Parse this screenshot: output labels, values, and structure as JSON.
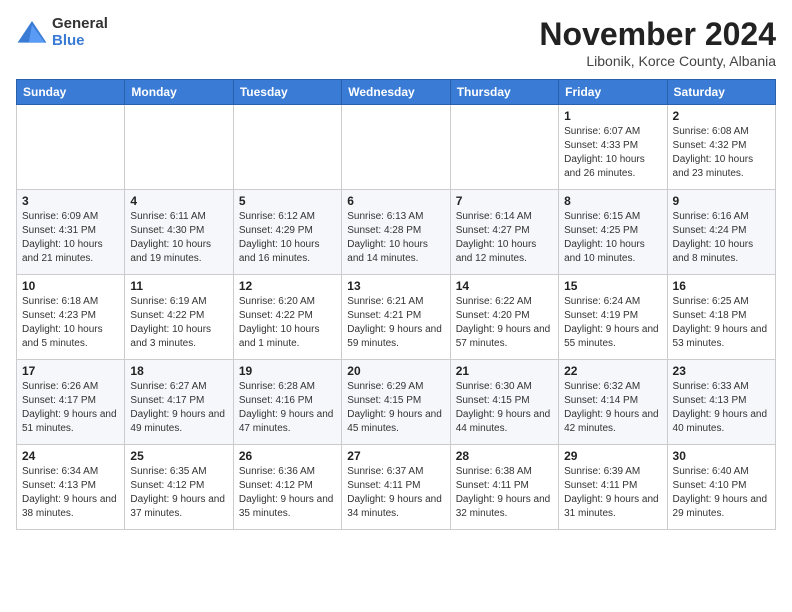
{
  "logo": {
    "general": "General",
    "blue": "Blue"
  },
  "title": "November 2024",
  "subtitle": "Libonik, Korce County, Albania",
  "days_of_week": [
    "Sunday",
    "Monday",
    "Tuesday",
    "Wednesday",
    "Thursday",
    "Friday",
    "Saturday"
  ],
  "weeks": [
    [
      {
        "day": "",
        "info": ""
      },
      {
        "day": "",
        "info": ""
      },
      {
        "day": "",
        "info": ""
      },
      {
        "day": "",
        "info": ""
      },
      {
        "day": "",
        "info": ""
      },
      {
        "day": "1",
        "info": "Sunrise: 6:07 AM\nSunset: 4:33 PM\nDaylight: 10 hours and 26 minutes."
      },
      {
        "day": "2",
        "info": "Sunrise: 6:08 AM\nSunset: 4:32 PM\nDaylight: 10 hours and 23 minutes."
      }
    ],
    [
      {
        "day": "3",
        "info": "Sunrise: 6:09 AM\nSunset: 4:31 PM\nDaylight: 10 hours and 21 minutes."
      },
      {
        "day": "4",
        "info": "Sunrise: 6:11 AM\nSunset: 4:30 PM\nDaylight: 10 hours and 19 minutes."
      },
      {
        "day": "5",
        "info": "Sunrise: 6:12 AM\nSunset: 4:29 PM\nDaylight: 10 hours and 16 minutes."
      },
      {
        "day": "6",
        "info": "Sunrise: 6:13 AM\nSunset: 4:28 PM\nDaylight: 10 hours and 14 minutes."
      },
      {
        "day": "7",
        "info": "Sunrise: 6:14 AM\nSunset: 4:27 PM\nDaylight: 10 hours and 12 minutes."
      },
      {
        "day": "8",
        "info": "Sunrise: 6:15 AM\nSunset: 4:25 PM\nDaylight: 10 hours and 10 minutes."
      },
      {
        "day": "9",
        "info": "Sunrise: 6:16 AM\nSunset: 4:24 PM\nDaylight: 10 hours and 8 minutes."
      }
    ],
    [
      {
        "day": "10",
        "info": "Sunrise: 6:18 AM\nSunset: 4:23 PM\nDaylight: 10 hours and 5 minutes."
      },
      {
        "day": "11",
        "info": "Sunrise: 6:19 AM\nSunset: 4:22 PM\nDaylight: 10 hours and 3 minutes."
      },
      {
        "day": "12",
        "info": "Sunrise: 6:20 AM\nSunset: 4:22 PM\nDaylight: 10 hours and 1 minute."
      },
      {
        "day": "13",
        "info": "Sunrise: 6:21 AM\nSunset: 4:21 PM\nDaylight: 9 hours and 59 minutes."
      },
      {
        "day": "14",
        "info": "Sunrise: 6:22 AM\nSunset: 4:20 PM\nDaylight: 9 hours and 57 minutes."
      },
      {
        "day": "15",
        "info": "Sunrise: 6:24 AM\nSunset: 4:19 PM\nDaylight: 9 hours and 55 minutes."
      },
      {
        "day": "16",
        "info": "Sunrise: 6:25 AM\nSunset: 4:18 PM\nDaylight: 9 hours and 53 minutes."
      }
    ],
    [
      {
        "day": "17",
        "info": "Sunrise: 6:26 AM\nSunset: 4:17 PM\nDaylight: 9 hours and 51 minutes."
      },
      {
        "day": "18",
        "info": "Sunrise: 6:27 AM\nSunset: 4:17 PM\nDaylight: 9 hours and 49 minutes."
      },
      {
        "day": "19",
        "info": "Sunrise: 6:28 AM\nSunset: 4:16 PM\nDaylight: 9 hours and 47 minutes."
      },
      {
        "day": "20",
        "info": "Sunrise: 6:29 AM\nSunset: 4:15 PM\nDaylight: 9 hours and 45 minutes."
      },
      {
        "day": "21",
        "info": "Sunrise: 6:30 AM\nSunset: 4:15 PM\nDaylight: 9 hours and 44 minutes."
      },
      {
        "day": "22",
        "info": "Sunrise: 6:32 AM\nSunset: 4:14 PM\nDaylight: 9 hours and 42 minutes."
      },
      {
        "day": "23",
        "info": "Sunrise: 6:33 AM\nSunset: 4:13 PM\nDaylight: 9 hours and 40 minutes."
      }
    ],
    [
      {
        "day": "24",
        "info": "Sunrise: 6:34 AM\nSunset: 4:13 PM\nDaylight: 9 hours and 38 minutes."
      },
      {
        "day": "25",
        "info": "Sunrise: 6:35 AM\nSunset: 4:12 PM\nDaylight: 9 hours and 37 minutes."
      },
      {
        "day": "26",
        "info": "Sunrise: 6:36 AM\nSunset: 4:12 PM\nDaylight: 9 hours and 35 minutes."
      },
      {
        "day": "27",
        "info": "Sunrise: 6:37 AM\nSunset: 4:11 PM\nDaylight: 9 hours and 34 minutes."
      },
      {
        "day": "28",
        "info": "Sunrise: 6:38 AM\nSunset: 4:11 PM\nDaylight: 9 hours and 32 minutes."
      },
      {
        "day": "29",
        "info": "Sunrise: 6:39 AM\nSunset: 4:11 PM\nDaylight: 9 hours and 31 minutes."
      },
      {
        "day": "30",
        "info": "Sunrise: 6:40 AM\nSunset: 4:10 PM\nDaylight: 9 hours and 29 minutes."
      }
    ]
  ]
}
